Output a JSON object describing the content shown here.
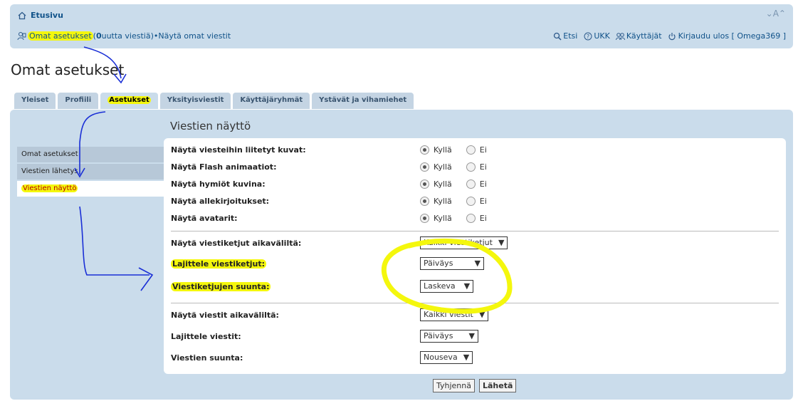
{
  "header": {
    "home_label": "Etusivu",
    "fontsize_label": "⌄A⌃",
    "ucp_label": "Omat asetukset",
    "unread_open": " (",
    "unread_count": "0",
    "unread_rest": " uutta viestiä)",
    "bullet": " • ",
    "view_posts": "Näytä omat viestit",
    "search": "Etsi",
    "faq": "UKK",
    "members": "Käyttäjät",
    "logout": "Kirjaudu ulos [ Omega369 ]"
  },
  "page_title": "Omat asetukset",
  "tabs": [
    {
      "label": "Yleiset"
    },
    {
      "label": "Profiili"
    },
    {
      "label": "Asetukset"
    },
    {
      "label": "Yksityisviestit"
    },
    {
      "label": "Käyttäjäryhmät"
    },
    {
      "label": "Ystävät ja vihamiehet"
    }
  ],
  "sidebar": [
    {
      "label": "Omat asetukset"
    },
    {
      "label": "Viestien lähetys"
    },
    {
      "label": "Viestien näyttö"
    }
  ],
  "section_title": "Viestien näyttö",
  "radio_rows": [
    {
      "label": "Näytä viesteihin liitetyt kuvat:",
      "yes": "Kyllä",
      "no": "Ei"
    },
    {
      "label": "Näytä Flash animaatiot:",
      "yes": "Kyllä",
      "no": "Ei"
    },
    {
      "label": "Näytä hymiöt kuvina:",
      "yes": "Kyllä",
      "no": "Ei"
    },
    {
      "label": "Näytä allekirjoitukset:",
      "yes": "Kyllä",
      "no": "Ei"
    },
    {
      "label": "Näytä avatarit:",
      "yes": "Kyllä",
      "no": "Ei"
    }
  ],
  "topic_rows": [
    {
      "label": "Näytä viestiketjut aikaväliltä:",
      "value": "Kaikki viestiketjut"
    },
    {
      "label": "Lajittele viestiketjut:",
      "value": "Päiväys"
    },
    {
      "label": "Viestiketjujen suunta:",
      "value": "Laskeva"
    }
  ],
  "post_rows": [
    {
      "label": "Näytä viestit aikaväliltä:",
      "value": "Kaikki viestit"
    },
    {
      "label": "Lajittele viestit:",
      "value": "Päiväys"
    },
    {
      "label": "Viestien suunta:",
      "value": "Nouseva"
    }
  ],
  "buttons": {
    "reset": "Tyhjennä",
    "submit": "Lähetä"
  },
  "colors": {
    "highlight": "#f4f70d",
    "annotation": "#1a2fd6",
    "panel": "#cadceb",
    "link": "#105289"
  }
}
